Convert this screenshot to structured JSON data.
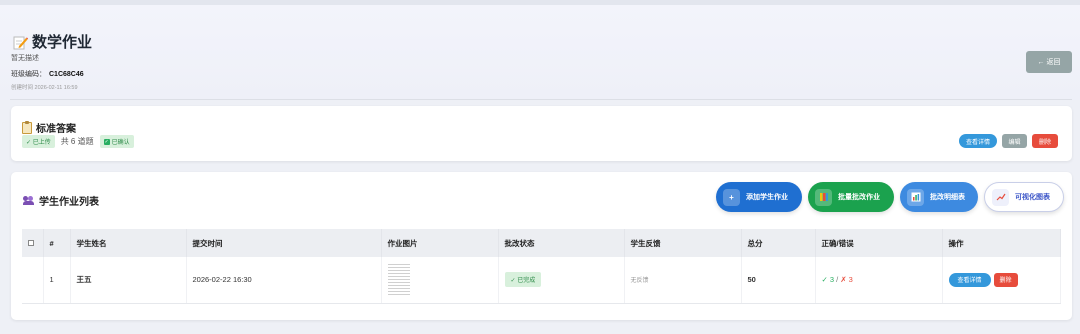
{
  "header": {
    "title": "数学作业",
    "description": "暂无描述",
    "class_code_label": "班级编码：",
    "class_code": "C1C68C46",
    "created": "创建时间 2026-02-11 16:59",
    "back_label": "← 返回"
  },
  "answer": {
    "title": "标准答案",
    "uploaded_tag": "✓ 已上传",
    "question_count": "共 6 道题",
    "confirmed_tag": "已确认",
    "buttons": {
      "detail": "查看详情",
      "edit": "编辑",
      "delete": "删除"
    }
  },
  "student_list": {
    "title": "学生作业列表",
    "actions": {
      "add": "添加学生作业",
      "batch": "批量批改作业",
      "detail": "批改明细表",
      "viz": "可视化图表"
    },
    "columns": [
      "#",
      "学生姓名",
      "提交时间",
      "作业图片",
      "批改状态",
      "学生反馈",
      "总分",
      "正确/错误",
      "操作"
    ],
    "rows": [
      {
        "index": "1",
        "name": "王五",
        "submitted": "2026-02-22 16:30",
        "status": "✓ 已完成",
        "feedback": "无反馈",
        "score": "50",
        "correct": "✓ 3",
        "sep": " / ",
        "wrong": "✗ 3",
        "detail_btn": "查看详情",
        "delete_btn": "删除"
      }
    ]
  },
  "colors": {
    "back": "#95a5a6",
    "primary": "#3498db",
    "danger": "#e74c3c",
    "success": "#27ae60"
  }
}
